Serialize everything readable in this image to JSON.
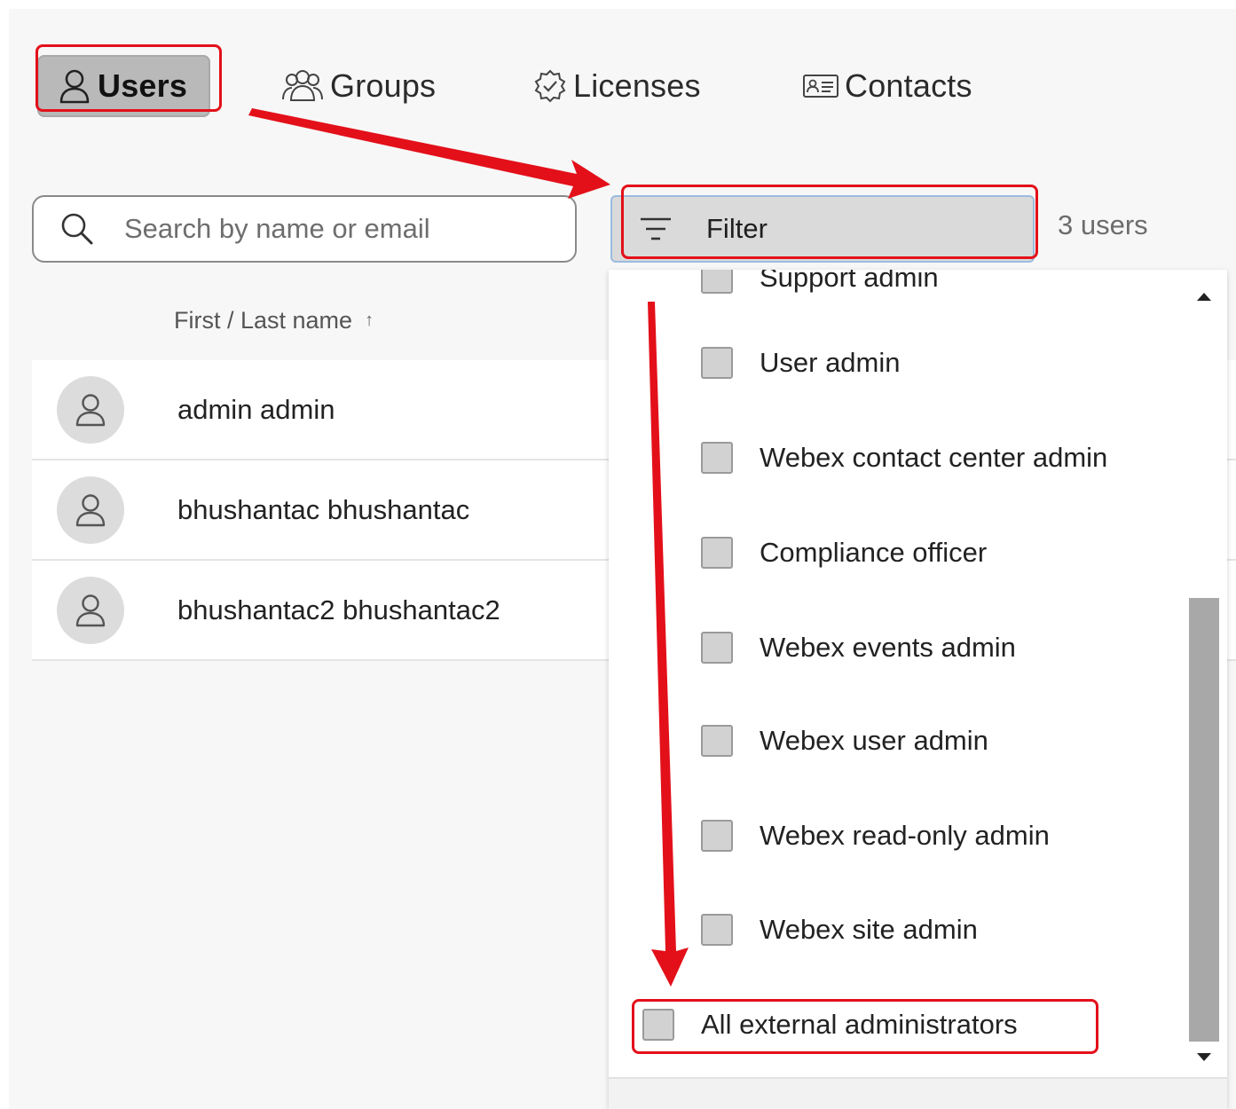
{
  "tabs": [
    {
      "label": "Users",
      "icon": "user-icon",
      "active": true
    },
    {
      "label": "Groups",
      "icon": "group-icon",
      "active": false
    },
    {
      "label": "Licenses",
      "icon": "license-badge-icon",
      "active": false
    },
    {
      "label": "Contacts",
      "icon": "contact-card-icon",
      "active": false
    }
  ],
  "search": {
    "placeholder": "Search by name or email"
  },
  "filter": {
    "label": "Filter"
  },
  "user_count": "3 users",
  "table": {
    "column_header": "First / Last name",
    "sort_indicator": "↑",
    "rows": [
      {
        "name": "admin admin"
      },
      {
        "name": "bhushantac bhushantac"
      },
      {
        "name": "bhushantac2 bhushantac2"
      }
    ]
  },
  "filter_options": [
    {
      "label": "Support admin",
      "checked": false
    },
    {
      "label": "User admin",
      "checked": false
    },
    {
      "label": "Webex contact center admin",
      "checked": false
    },
    {
      "label": "Compliance officer",
      "checked": false
    },
    {
      "label": "Webex events admin",
      "checked": false
    },
    {
      "label": "Webex user admin",
      "checked": false
    },
    {
      "label": "Webex read-only admin",
      "checked": false
    },
    {
      "label": "Webex site admin",
      "checked": false
    },
    {
      "label": "All external administrators",
      "checked": false
    }
  ],
  "colors": {
    "annotation_red": "#e3101a",
    "active_tab_bg": "#b9b9b9",
    "filter_bg": "#dadada",
    "scrollbar": "#a8a8a8"
  }
}
